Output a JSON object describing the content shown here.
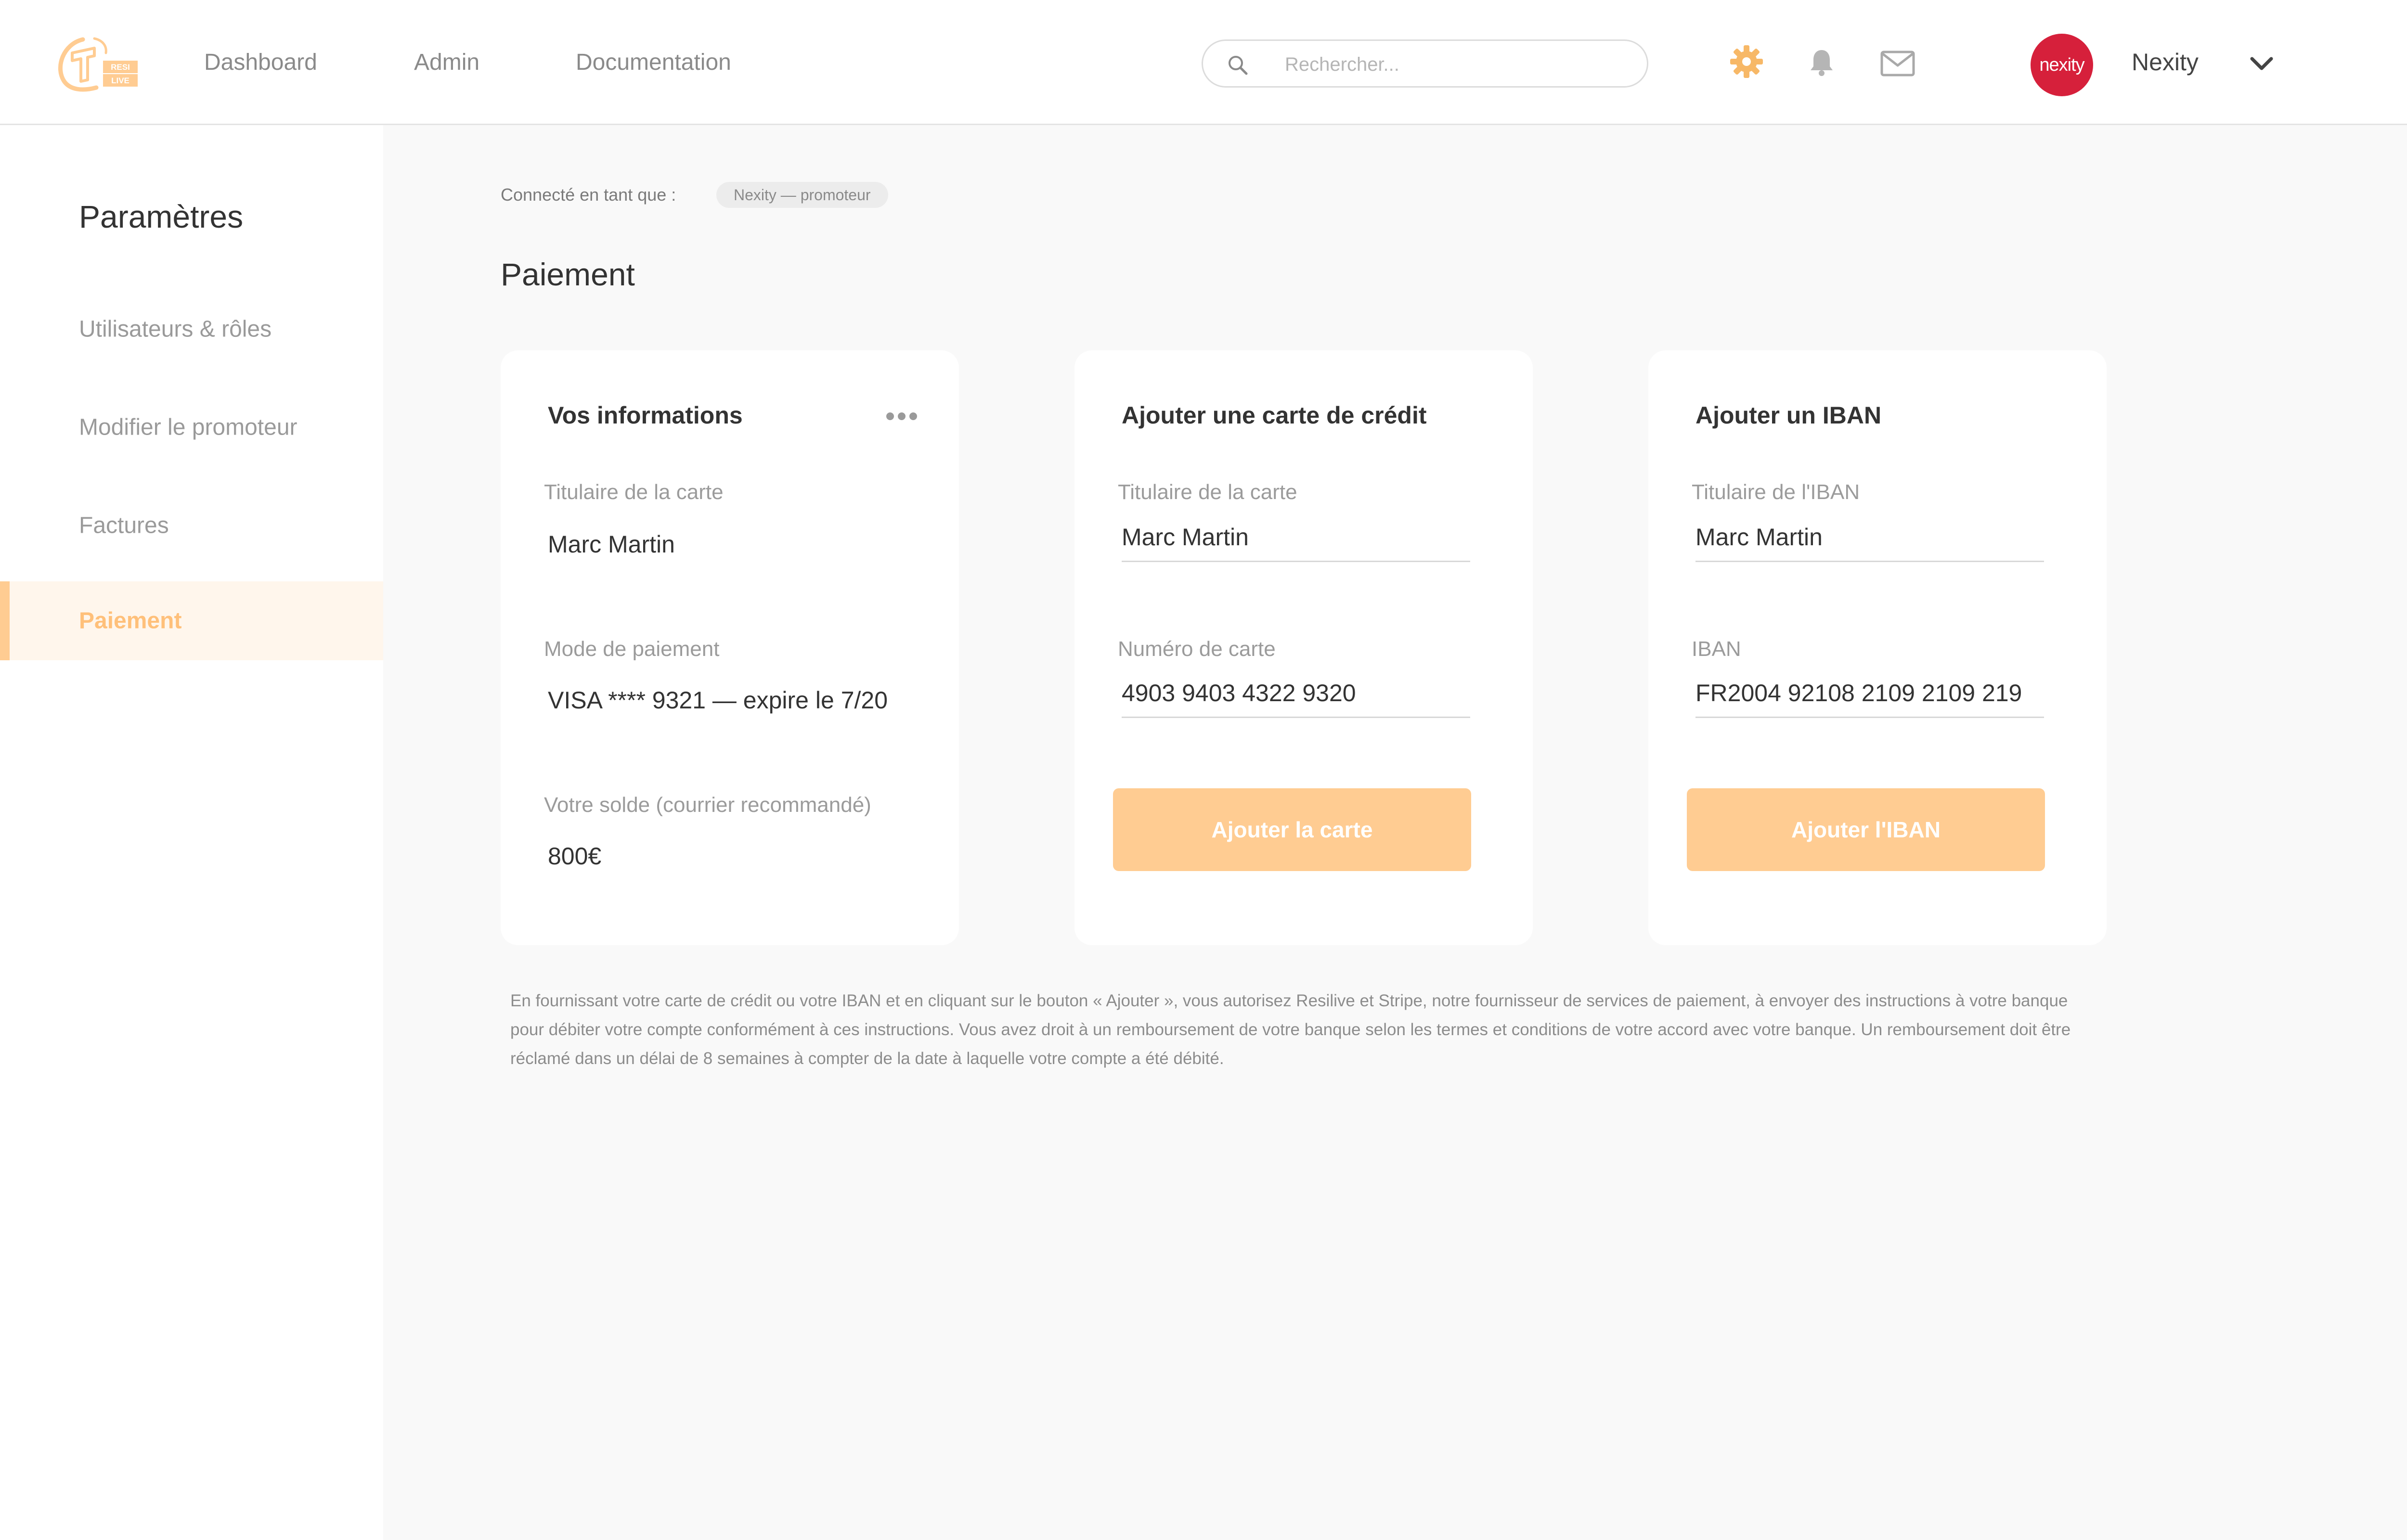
{
  "brand": {
    "logo_icon": "resilive-logo-icon",
    "logo_text": "RESI LIVE",
    "accent": "#ffcc92",
    "accent_text": "#ffc07a",
    "gear_color": "#f7b867",
    "avatar_color": "#d6203b"
  },
  "header": {
    "nav": [
      "Dashboard",
      "Admin",
      "Documentation"
    ],
    "search_placeholder": "Rechercher...",
    "icons": [
      "search-icon",
      "gear-icon",
      "bell-icon",
      "mail-icon",
      "chevron-down-icon"
    ],
    "avatar_text": "nexity",
    "user_name": "Nexity"
  },
  "sidebar": {
    "title": "Paramètres",
    "items": [
      {
        "label": "Utilisateurs & rôles",
        "active": false
      },
      {
        "label": "Modifier le promoteur",
        "active": false
      },
      {
        "label": "Factures",
        "active": false
      },
      {
        "label": "Paiement",
        "active": true
      }
    ]
  },
  "main": {
    "connected_label": "Connecté en tant que :",
    "connected_role": "Nexity — promoteur",
    "page_title": "Paiement",
    "info_card": {
      "title": "Vos informations",
      "holder_label": "Titulaire de la carte",
      "holder_value": "Marc Martin",
      "payment_label": "Mode de paiement",
      "payment_value": "VISA **** 9321 — expire le 7/20",
      "balance_label": "Votre solde (courrier recommandé)",
      "balance_value": "800€"
    },
    "card_form": {
      "title": "Ajouter une carte de crédit",
      "holder_label": "Titulaire de la carte",
      "holder_value": "Marc Martin",
      "number_label": "Numéro de carte",
      "number_value": "4903 9403 4322 9320",
      "button": "Ajouter la carte"
    },
    "iban_form": {
      "title": "Ajouter un IBAN",
      "holder_label": "Titulaire de l'IBAN",
      "holder_value": "Marc Martin",
      "iban_label": "IBAN",
      "iban_value": "FR2004 92108 2109 2109 219",
      "button": "Ajouter l'IBAN"
    },
    "legal_text": "En fournissant votre carte de crédit ou votre IBAN et en cliquant sur le bouton « Ajouter », vous autorisez Resilive et Stripe, notre fournisseur de services de paiement, à envoyer des instructions à votre banque pour débiter votre compte conformément à ces instructions. Vous avez droit à un remboursement de votre banque selon les termes et conditions de votre accord avec votre banque. Un remboursement doit être réclamé dans un délai de 8 semaines à compter de la date à laquelle votre compte a été débité."
  }
}
